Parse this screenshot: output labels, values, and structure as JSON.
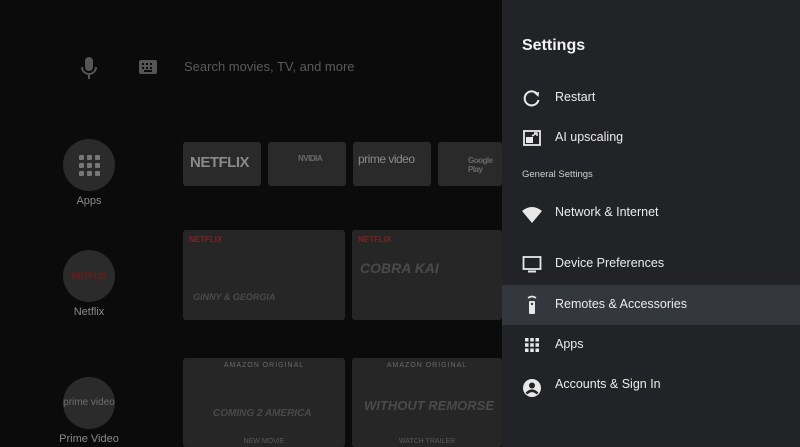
{
  "search": {
    "placeholder": "Search movies, TV, and more"
  },
  "rail": [
    {
      "label": "Apps"
    },
    {
      "label": "Netflix",
      "icon_text": "NETFLIX"
    },
    {
      "label": "Prime Video",
      "icon_text": "prime video"
    }
  ],
  "app_tiles": [
    {
      "label": "NETFLIX"
    },
    {
      "label": "NVIDIA"
    },
    {
      "label": "prime video"
    },
    {
      "label": "Google Play"
    }
  ],
  "netflix_row": [
    {
      "badge": "NETFLIX",
      "title": "GINNY & GEORGIA"
    },
    {
      "badge": "NETFLIX",
      "title": "COBRA KAI"
    }
  ],
  "prime_row": [
    {
      "top": "AMAZON ORIGINAL",
      "title": "COMING 2 AMERICA",
      "caption": "NEW MOVIE"
    },
    {
      "top": "AMAZON ORIGINAL",
      "title": "WITHOUT REMORSE",
      "caption": "WATCH TRAILER"
    }
  ],
  "settings": {
    "title": "Settings",
    "items": [
      {
        "label": "Restart",
        "icon": "restart-icon"
      },
      {
        "label": "AI upscaling",
        "icon": "ai-upscaling-icon"
      }
    ],
    "section_header": "General Settings",
    "general": [
      {
        "label": "Network & Internet",
        "icon": "wifi-icon"
      },
      {
        "label": "Device Preferences",
        "icon": "tv-icon"
      },
      {
        "label": "Remotes & Accessories",
        "icon": "remote-icon",
        "focused": true
      },
      {
        "label": "Apps",
        "icon": "apps-grid-icon"
      },
      {
        "label": "Accounts & Sign In",
        "icon": "account-icon"
      }
    ]
  },
  "colors": {
    "panel_bg": "#222326",
    "focus_bg": "#34373d",
    "text": "#ececec"
  }
}
